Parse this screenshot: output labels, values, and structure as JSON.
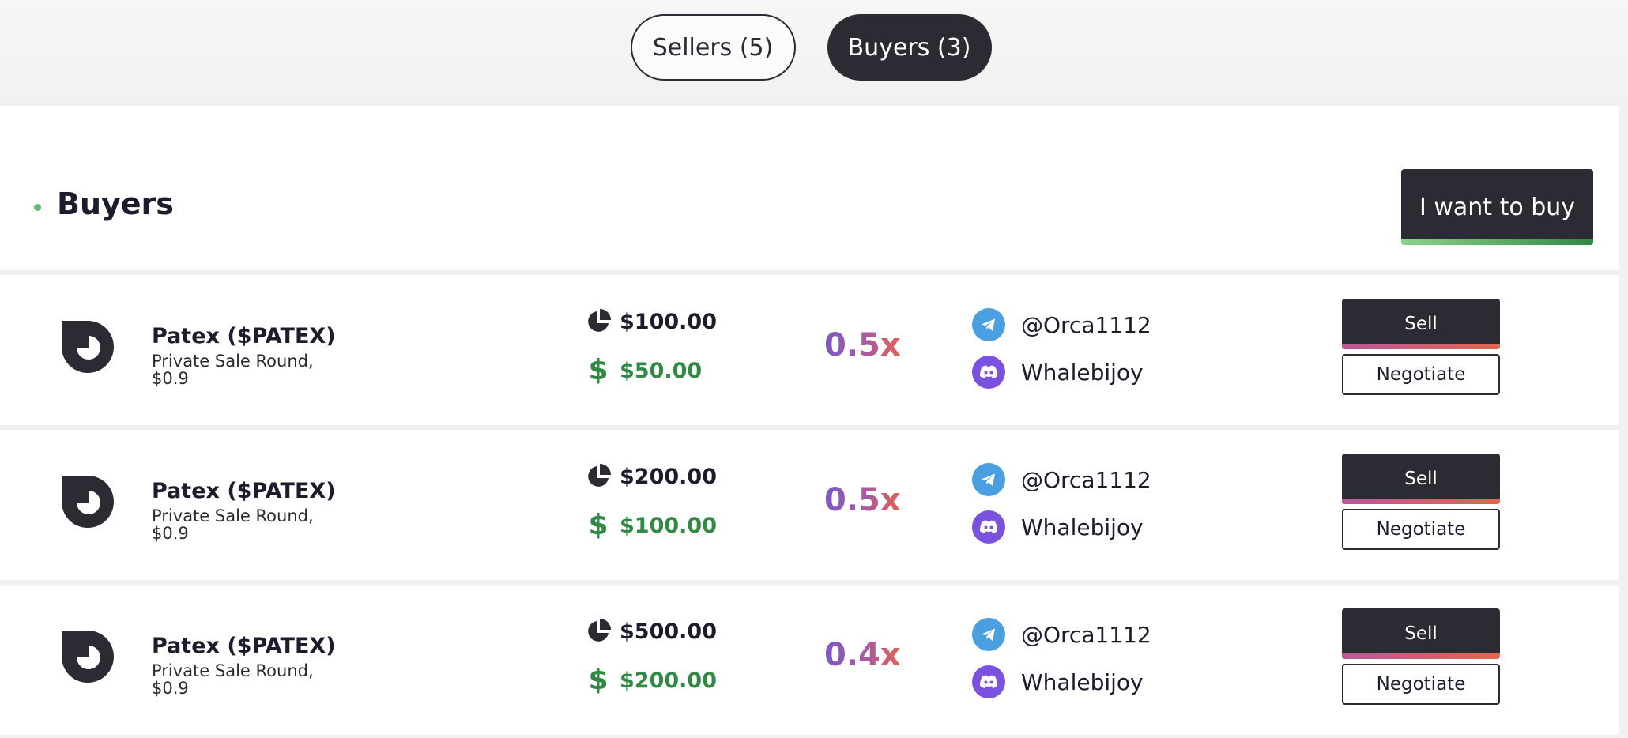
{
  "tabs": {
    "sellers_label": "Sellers (5)",
    "buyers_label": "Buyers (3)",
    "active": "buyers"
  },
  "section": {
    "title": "Buyers",
    "want_buy_label": "I want to buy"
  },
  "colors": {
    "dark": "#2b2c33",
    "green": "#2f8a44",
    "telegram": "#4a9fe0",
    "discord": "#7b52e0",
    "bullet": "#5bbf73"
  },
  "icons": {
    "allocation": "pie-chart-icon",
    "price": "dollar-icon",
    "telegram": "telegram-icon",
    "discord": "discord-icon",
    "token": "patex-logo-icon"
  },
  "rows": [
    {
      "token": "Patex ($PATEX)",
      "round": "Private Sale Round, $0.9",
      "allocation": "$100.00",
      "price": "$50.00",
      "multiplier": "0.5x",
      "telegram": "@Orca1112",
      "discord": "Whalebijoy",
      "sell_label": "Sell",
      "negotiate_label": "Negotiate"
    },
    {
      "token": "Patex ($PATEX)",
      "round": "Private Sale Round, $0.9",
      "allocation": "$200.00",
      "price": "$100.00",
      "multiplier": "0.5x",
      "telegram": "@Orca1112",
      "discord": "Whalebijoy",
      "sell_label": "Sell",
      "negotiate_label": "Negotiate"
    },
    {
      "token": "Patex ($PATEX)",
      "round": "Private Sale Round, $0.9",
      "allocation": "$500.00",
      "price": "$200.00",
      "multiplier": "0.4x",
      "telegram": "@Orca1112",
      "discord": "Whalebijoy",
      "sell_label": "Sell",
      "negotiate_label": "Negotiate"
    }
  ]
}
